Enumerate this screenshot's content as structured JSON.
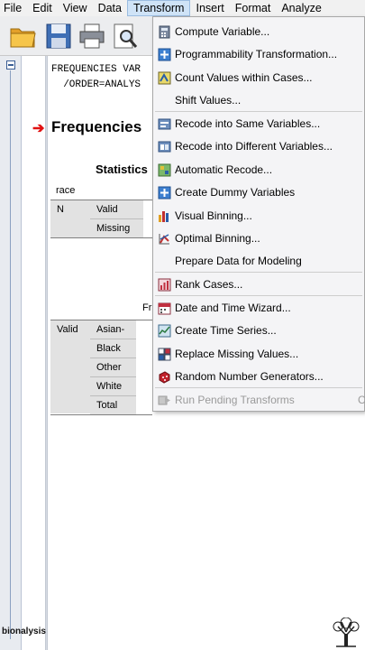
{
  "menubar": {
    "items": [
      {
        "label": "File"
      },
      {
        "label": "Edit"
      },
      {
        "label": "View"
      },
      {
        "label": "Data"
      },
      {
        "label": "Transform"
      },
      {
        "label": "Insert"
      },
      {
        "label": "Format"
      },
      {
        "label": "Analyze"
      }
    ]
  },
  "toolbar": {
    "icons": [
      "open-folder-icon",
      "save-icon",
      "print-icon",
      "print-preview-icon"
    ]
  },
  "output": {
    "syntax_line1": "FREQUENCIES VAR",
    "syntax_line2": "  /ORDER=ANALYS",
    "heading": "Frequencies",
    "statistics_title": "Statistics",
    "stats_variable": "race",
    "stats_rows": [
      {
        "group": "N",
        "label": "Valid"
      },
      {
        "label": "Missing"
      }
    ],
    "freq_header_fragment": "Fr",
    "freq_group": "Valid",
    "freq_rows": [
      "Asian-",
      "Black",
      "Other",
      "White",
      "Total"
    ]
  },
  "transform_menu": {
    "items": [
      {
        "label": "Compute Variable...",
        "icon": "calculator-icon"
      },
      {
        "label": "Programmability Transformation...",
        "icon": "plus-square-icon"
      },
      {
        "label": "Count Values within Cases...",
        "icon": "count-values-icon"
      },
      {
        "label": "Shift Values...",
        "icon": ""
      },
      {
        "label": "Recode into Same Variables...",
        "icon": "recode-same-icon"
      },
      {
        "label": "Recode into Different Variables...",
        "icon": "recode-different-icon"
      },
      {
        "label": "Automatic Recode...",
        "icon": "auto-recode-icon"
      },
      {
        "label": "Create Dummy Variables",
        "icon": "plus-square-icon"
      },
      {
        "label": "Visual Binning...",
        "icon": "visual-binning-icon"
      },
      {
        "label": "Optimal Binning...",
        "icon": "optimal-binning-icon"
      },
      {
        "label": "Prepare Data for Modeling",
        "icon": ""
      },
      {
        "label": "Rank Cases...",
        "icon": "rank-cases-icon"
      },
      {
        "label": "Date and Time Wizard...",
        "icon": "calendar-icon"
      },
      {
        "label": "Create Time Series...",
        "icon": "time-series-icon"
      },
      {
        "label": "Replace Missing Values...",
        "icon": "replace-missing-icon"
      },
      {
        "label": "Random Number Generators...",
        "icon": "dice-icon"
      },
      {
        "label": "Run Pending Transforms",
        "icon": "run-pending-icon",
        "shortcut": "C"
      }
    ]
  },
  "footer": {
    "logo_text": "bionalysis",
    "tree_icon": "tree-logo-icon"
  },
  "colors": {
    "menu_highlight": "#cfe3f7",
    "arrow_red": "#e01010",
    "table_header_gray": "#e2e2e2",
    "disabled_text": "#9a9a9a"
  }
}
